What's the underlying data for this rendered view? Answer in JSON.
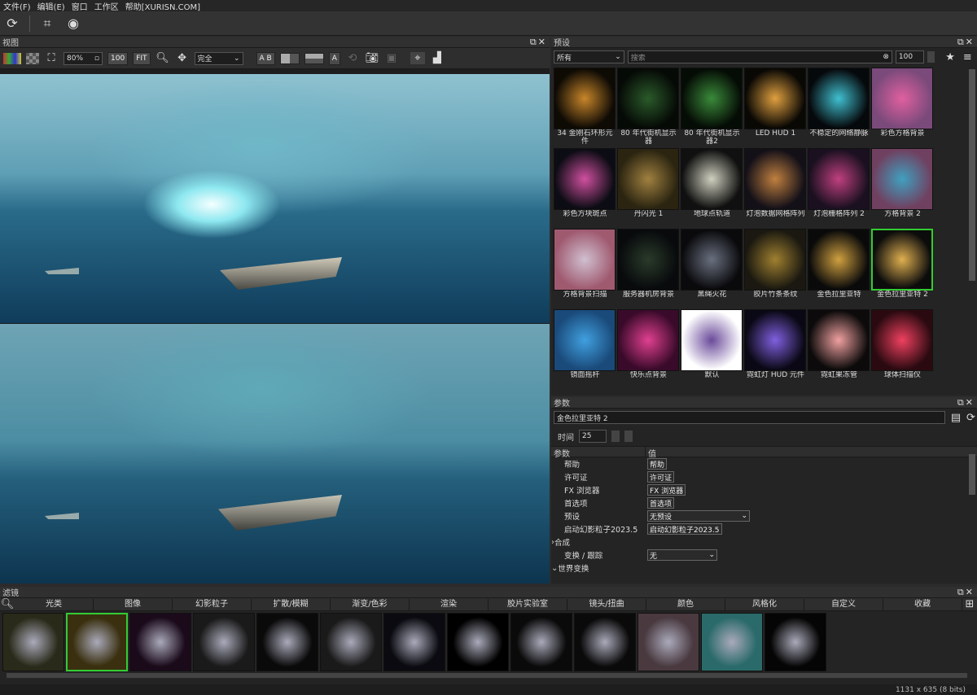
{
  "menu": [
    "文件(F)",
    "编辑(E)",
    "窗口",
    "工作区",
    "帮助[XURISN.COM]"
  ],
  "view": {
    "title": "视图",
    "zoom": "80%",
    "btn100": "100",
    "fit": "FIT",
    "mode": "完全",
    "ab": "A B"
  },
  "presets": {
    "title": "预设",
    "category": "所有",
    "search_placeholder": "搜索",
    "size": "100",
    "items": [
      {
        "label": "34 金刚石环形元件",
        "bg": "#0e0a04",
        "fg": "#c8862a"
      },
      {
        "label": "80 年代街机显示器",
        "bg": "#060a06",
        "fg": "#2a5a2a"
      },
      {
        "label": "80 年代街机显示器2",
        "bg": "#050c05",
        "fg": "#3a8a3a"
      },
      {
        "label": "LED HUD 1",
        "bg": "#0a0804",
        "fg": "#e0a040"
      },
      {
        "label": "不稳定的网络静脉",
        "bg": "#06090c",
        "fg": "#40c0d0"
      },
      {
        "label": "彩色方格背景",
        "bg": "#7a4a7a",
        "fg": "#e060a0"
      },
      {
        "label": "彩色方块斑点",
        "bg": "#0c0c14",
        "fg": "#d050a0"
      },
      {
        "label": "丹闪光 1",
        "bg": "#2a2410",
        "fg": "#a08040"
      },
      {
        "label": "地球点轨道",
        "bg": "#101010",
        "fg": "#d0d0c0"
      },
      {
        "label": "灯泡数据网格阵列",
        "bg": "#141018",
        "fg": "#c08040"
      },
      {
        "label": "灯泡栅格阵列 2",
        "bg": "#1a1020",
        "fg": "#c04080"
      },
      {
        "label": "方格背景 2",
        "bg": "#704060",
        "fg": "#40a0c0"
      },
      {
        "label": "方格背景扫描",
        "bg": "#a05a70",
        "fg": "#d0c0d0"
      },
      {
        "label": "服务器机房背景",
        "bg": "#080a0c",
        "fg": "#2a3a2a"
      },
      {
        "label": "黑绳火花",
        "bg": "#0a0a0c",
        "fg": "#6a7080"
      },
      {
        "label": "胶片竹条条纹",
        "bg": "#1a1810",
        "fg": "#a08030"
      },
      {
        "label": "金色拉里亚特",
        "bg": "#0a0a0a",
        "fg": "#d0a040"
      },
      {
        "label": "金色拉里亚特 2",
        "bg": "#0c0c0c",
        "fg": "#e0b050"
      },
      {
        "label": "镜面摇杆",
        "bg": "#1a4a7a",
        "fg": "#40a0e0"
      },
      {
        "label": "快乐点背景",
        "bg": "#3a0a2a",
        "fg": "#e04090"
      },
      {
        "label": "默认",
        "bg": "#ffffff",
        "fg": "#6a4a9a"
      },
      {
        "label": "霓虹灯 HUD 元件",
        "bg": "#0a0814",
        "fg": "#8060e0"
      },
      {
        "label": "霓虹果冻管",
        "bg": "#0c0a0a",
        "fg": "#f0a0a0"
      },
      {
        "label": "球体扫描仪",
        "bg": "#2a0a10",
        "fg": "#f04060"
      }
    ]
  },
  "params": {
    "title": "参数",
    "preset_name": "金色拉里亚特 2",
    "time_label": "时间",
    "time_value": "25",
    "col_param": "参数",
    "col_value": "值",
    "rows": [
      {
        "name": "帮助",
        "value": "帮助",
        "kind": "button"
      },
      {
        "name": "许可证",
        "value": "许可证",
        "kind": "button"
      },
      {
        "name": "FX 浏览器",
        "value": "FX 浏览器",
        "kind": "button"
      },
      {
        "name": "首选项",
        "value": "首选项",
        "kind": "button"
      },
      {
        "name": "预设",
        "value": "无预设",
        "kind": "select"
      },
      {
        "name": "启动幻影粒子2023.5",
        "value": "启动幻影粒子2023.5",
        "kind": "button"
      },
      {
        "name": "合成",
        "value": "",
        "kind": "group"
      },
      {
        "name": "变换 / 跟踪",
        "value": "无",
        "kind": "select"
      },
      {
        "name": "世界变换",
        "value": "",
        "kind": "group-open"
      }
    ]
  },
  "filters": {
    "title": "滤镜",
    "tabs": [
      "光类",
      "图像",
      "幻影粒子",
      "扩散/模糊",
      "渐变/色彩",
      "渲染",
      "胶片实验室",
      "镜头/扭曲",
      "颜色",
      "风格化",
      "自定义",
      "收藏"
    ],
    "thumbs": [
      "#2a2a1a",
      "#3a3010",
      "#1a0a1a",
      "#1a1a1a",
      "#0a0a0a",
      "#1a1a1a",
      "#0a0a10",
      "#000000",
      "#0a0a0a",
      "#0a0a0a",
      "#4a3a40",
      "#2a6a6a",
      "#050505"
    ]
  },
  "status": "1131 x 635 (8 bits)"
}
